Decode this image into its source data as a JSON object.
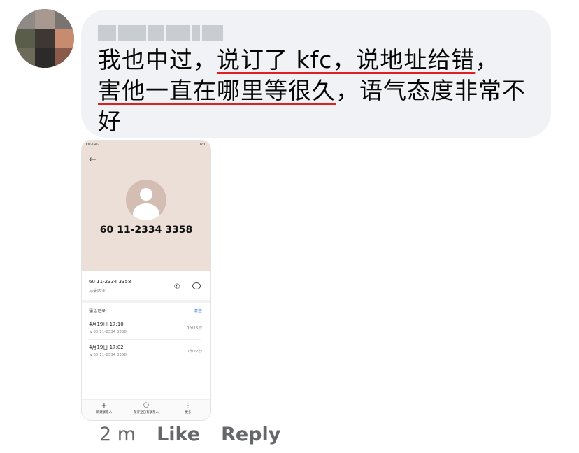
{
  "comment": {
    "author": "",
    "text_before": "我也中过，",
    "underline_1": "说订了 kfc，说地址给错",
    "text_middle": "，",
    "underline_2": "害他一直在哪里等很久",
    "text_after": "，语气态度非常不好"
  },
  "attachment": {
    "status_left": "DiGi 4G",
    "status_right": "07:0",
    "phone_number": "60 11-2334 3358",
    "number_detail": "60 11-2334 3358",
    "location": "马来西亚",
    "history_title": "通话记录",
    "clear_label": "清空",
    "calls": [
      {
        "datetime": "4月19日 17:10",
        "number": "60 11-2334 3358",
        "duration": "1分15秒"
      },
      {
        "datetime": "4月19日 17:02",
        "number": "60 11-2334 3358",
        "duration": "1分27秒"
      }
    ],
    "bottom_tabs": [
      {
        "icon": "plus-icon",
        "label": "新建联系人"
      },
      {
        "icon": "person-icon",
        "label": "保存至已有联系人"
      },
      {
        "icon": "more-icon",
        "label": "更多"
      }
    ]
  },
  "actions": {
    "time": "2 m",
    "like_label": "Like",
    "reply_label": "Reply"
  },
  "colors": {
    "underline": "#e02020",
    "bubble_bg": "#f0f2f5",
    "meta_text": "#65676b"
  }
}
